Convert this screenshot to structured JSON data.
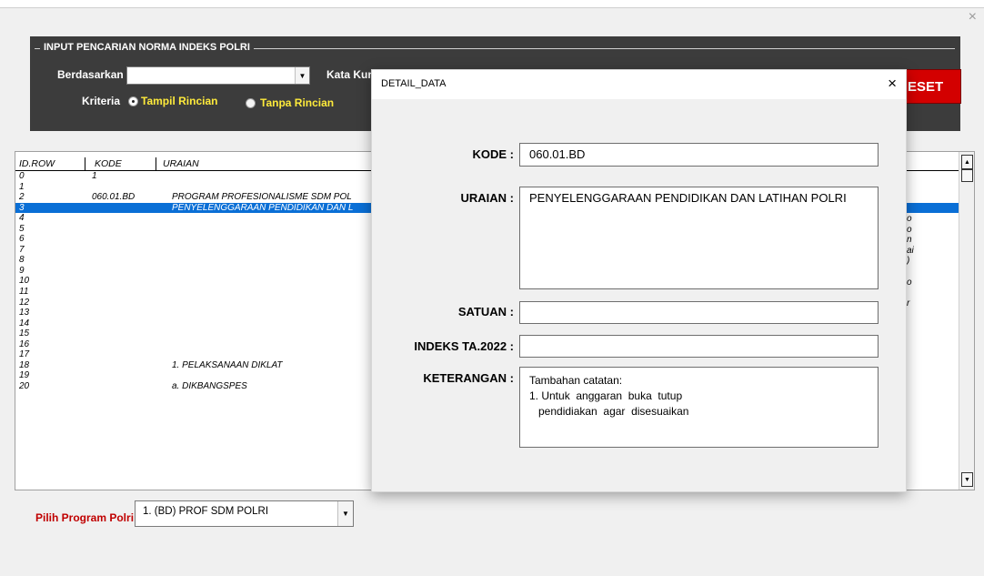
{
  "window": {
    "close_icon": "×"
  },
  "search_panel": {
    "group_title": "INPUT PENCARIAN NORMA INDEKS POLRI",
    "berdasarkan_label": "Berdasarkan",
    "berdasarkan_value": "",
    "kata_kunci_label": "Kata Kun",
    "kriteria_label": "Kriteria",
    "option_tampil": "Tampil Rincian",
    "option_tanpa": "Tanpa Rincian",
    "selected_option": "Tampil Rincian",
    "reset_label": "ESET"
  },
  "grid": {
    "headers": [
      "ID.ROW",
      "KODE",
      "URAIAN"
    ],
    "rows": [
      {
        "id": "0",
        "kode": "1",
        "uraian": ""
      },
      {
        "id": "1",
        "kode": "",
        "uraian": ""
      },
      {
        "id": "2",
        "kode": "060.01.BD",
        "uraian": "PROGRAM PROFESIONALISME SDM POL"
      },
      {
        "id": "3",
        "kode": "",
        "uraian": "PENYELENGGARAAN PENDIDIKAN DAN L",
        "selected": true
      },
      {
        "id": "4",
        "kode": "",
        "uraian": ""
      },
      {
        "id": "5",
        "kode": "",
        "uraian": ""
      },
      {
        "id": "6",
        "kode": "",
        "uraian": ""
      },
      {
        "id": "7",
        "kode": "",
        "uraian": ""
      },
      {
        "id": "8",
        "kode": "",
        "uraian": ""
      },
      {
        "id": "9",
        "kode": "",
        "uraian": ""
      },
      {
        "id": "10",
        "kode": "",
        "uraian": ""
      },
      {
        "id": "11",
        "kode": "",
        "uraian": ""
      },
      {
        "id": "12",
        "kode": "",
        "uraian": ""
      },
      {
        "id": "13",
        "kode": "",
        "uraian": ""
      },
      {
        "id": "14",
        "kode": "",
        "uraian": ""
      },
      {
        "id": "15",
        "kode": "",
        "uraian": ""
      },
      {
        "id": "16",
        "kode": "",
        "uraian": ""
      },
      {
        "id": "17",
        "kode": "",
        "uraian": ""
      },
      {
        "id": "18",
        "kode": "",
        "uraian": "1. PELAKSANAAN DIKLAT"
      },
      {
        "id": "19",
        "kode": "",
        "uraian": ""
      },
      {
        "id": "20",
        "kode": "",
        "uraian": "a. DIKBANGSPES"
      }
    ],
    "right_peek": [
      "o",
      "o",
      "n",
      "ai",
      ")",
      "",
      "o",
      "",
      "r"
    ]
  },
  "program": {
    "label": "Pilih Program Polri",
    "value": "1. (BD) PROF SDM POLRI"
  },
  "dialog": {
    "title": "DETAIL_DATA",
    "close_icon": "×",
    "kode_label": "KODE :",
    "kode_value": "060.01.BD",
    "uraian_label": "URAIAN :",
    "uraian_value": "PENYELENGGARAAN PENDIDIKAN DAN LATIHAN POLRI",
    "satuan_label": "SATUAN :",
    "satuan_value": "",
    "indeks_label": "INDEKS TA.2022 :",
    "indeks_value": "",
    "keterangan_label": "KETERANGAN :",
    "keterangan_value": "Tambahan catatan:\n1. Untuk  anggaran  buka  tutup\n   pendidiakan  agar  disesuaikan"
  }
}
